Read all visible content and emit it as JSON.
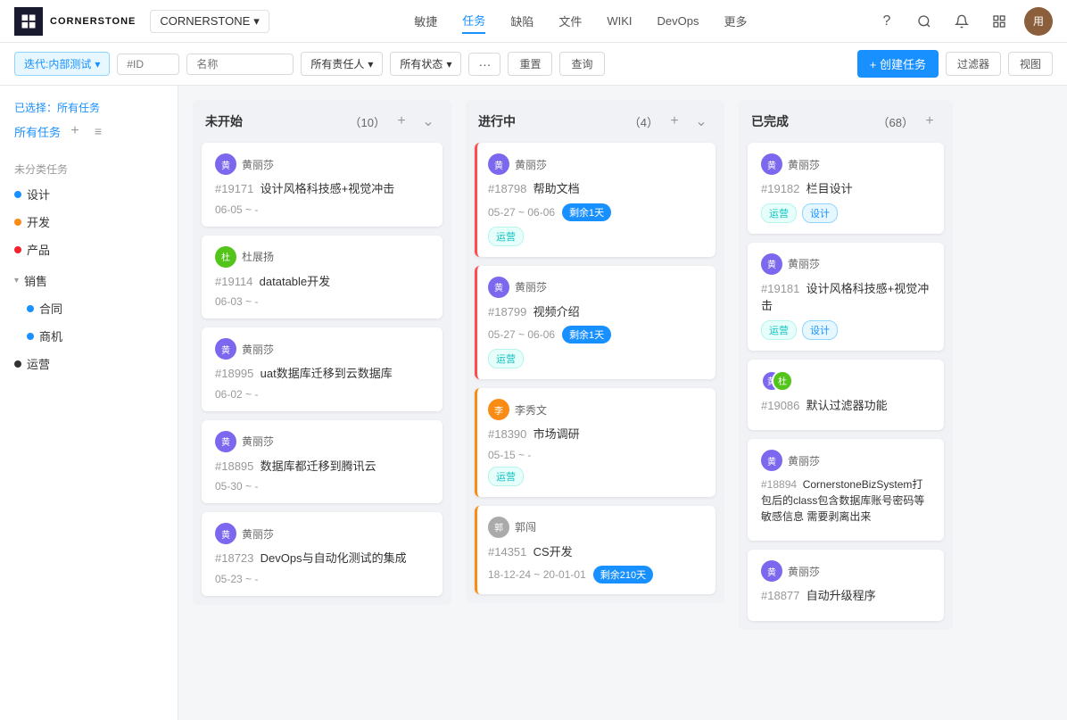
{
  "brand": {
    "logo_text": "CORNERSTONE",
    "app_name": "CORNERSTONE",
    "app_chevron": "▾"
  },
  "nav": {
    "links": [
      {
        "label": "敏捷",
        "active": false
      },
      {
        "label": "任务",
        "active": true
      },
      {
        "label": "缺陷",
        "active": false
      },
      {
        "label": "文件",
        "active": false
      },
      {
        "label": "WIKI",
        "active": false
      },
      {
        "label": "DevOps",
        "active": false
      },
      {
        "label": "更多",
        "active": false
      }
    ]
  },
  "filter_bar": {
    "iteration_label": "迭代:内部测试",
    "id_placeholder": "#ID",
    "name_placeholder": "名称",
    "owner_label": "所有责任人",
    "status_label": "所有状态",
    "dots_label": "···",
    "reset_label": "重置",
    "query_label": "查询",
    "create_label": "+ 创建任务",
    "filter_label": "过滤器",
    "view_label": "视图"
  },
  "sidebar": {
    "selected_prefix": "已选择：",
    "selected_value": "所有任务",
    "all_tasks_label": "所有任务",
    "unclassified_label": "未分类任务",
    "items": [
      {
        "label": "设计",
        "color": "#1890ff"
      },
      {
        "label": "开发",
        "color": "#fa8c16"
      },
      {
        "label": "产品",
        "color": "#f5222d"
      }
    ],
    "sales_group": {
      "label": "销售",
      "color": "#333",
      "items": [
        {
          "label": "合同",
          "color": "#1890ff"
        },
        {
          "label": "商机",
          "color": "#1890ff"
        }
      ]
    },
    "operations_label": "运营",
    "operations_color": "#333"
  },
  "board": {
    "columns": [
      {
        "title": "未开始",
        "count": 10,
        "cards": [
          {
            "user": "黄丽莎",
            "avatar_bg": "#7b68ee",
            "avatar_text": "黄",
            "id": "#19171",
            "title": "设计风格科技感+视觉冲击",
            "date": "06-05 ~ -",
            "tags": [],
            "border": ""
          },
          {
            "user": "杜展扬",
            "avatar_bg": "#52c41a",
            "avatar_text": "杜",
            "id": "#19114",
            "title": "datatable开发",
            "date": "06-03 ~ -",
            "tags": [],
            "border": ""
          },
          {
            "user": "黄丽莎",
            "avatar_bg": "#7b68ee",
            "avatar_text": "黄",
            "id": "#18995",
            "title": "uat数据库迁移到云数据库",
            "date": "06-02 ~ -",
            "tags": [],
            "border": ""
          },
          {
            "user": "黄丽莎",
            "avatar_bg": "#7b68ee",
            "avatar_text": "黄",
            "id": "#18895",
            "title": "数据库都迁移到腾讯云",
            "date": "05-30 ~ -",
            "tags": [],
            "border": ""
          },
          {
            "user": "黄丽莎",
            "avatar_bg": "#7b68ee",
            "avatar_text": "黄",
            "id": "#18723",
            "title": "DevOps与自动化测试的集成",
            "date": "05-23 ~ -",
            "tags": [],
            "border": ""
          }
        ]
      },
      {
        "title": "进行中",
        "count": 4,
        "cards": [
          {
            "user": "黄丽莎",
            "avatar_bg": "#7b68ee",
            "avatar_text": "黄",
            "id": "#18798",
            "title": "帮助文档",
            "date": "05-27 ~ 06-06",
            "badge": "剩余1天",
            "badge_color": "blue",
            "tags": [
              "运营"
            ],
            "border": "red"
          },
          {
            "user": "黄丽莎",
            "avatar_bg": "#7b68ee",
            "avatar_text": "黄",
            "id": "#18799",
            "title": "视频介绍",
            "date": "05-27 ~ 06-06",
            "badge": "剩余1天",
            "badge_color": "blue",
            "tags": [
              "运营"
            ],
            "border": "red"
          },
          {
            "user": "李秀文",
            "avatar_bg": "#fa8c16",
            "avatar_text": "李",
            "id": "#18390",
            "title": "市场调研",
            "date": "05-15 ~ -",
            "tags": [
              "运营"
            ],
            "border": "orange"
          },
          {
            "user": "郭闯",
            "avatar_bg": "#aaa",
            "avatar_text": "郭",
            "id": "#14351",
            "title": "CS开发",
            "date": "18-12-24 ~ 20-01-01",
            "badge": "剩余210天",
            "badge_color": "blue",
            "tags": [],
            "border": "orange"
          }
        ]
      },
      {
        "title": "已完成",
        "count": 68,
        "cards": [
          {
            "user": "黄丽莎",
            "avatar_bg": "#7b68ee",
            "avatar_text": "黄",
            "id": "#19182",
            "title": "栏目设计",
            "tags": [
              "运营",
              "设计"
            ],
            "border": ""
          },
          {
            "user": "黄丽莎",
            "avatar_bg": "#7b68ee",
            "avatar_text": "黄",
            "id": "#19181",
            "title": "设计风格科技感+视觉冲击",
            "tags": [
              "运营",
              "设计"
            ],
            "border": ""
          },
          {
            "user_multi": true,
            "avatar_bg1": "#7b68ee",
            "avatar_text1": "黄",
            "avatar_bg2": "#52c41a",
            "avatar_text2": "杜",
            "id": "#19086",
            "title": "默认过滤器功能",
            "tags": [],
            "border": ""
          },
          {
            "user": "黄丽莎",
            "avatar_bg": "#7b68ee",
            "avatar_text": "黄",
            "id": "#18894",
            "title": "CornerstoneBizSystem打包后的class包含数据库账号密码等敏感信息 需要剥离出来",
            "tags": [],
            "border": ""
          },
          {
            "user": "黄丽莎",
            "avatar_bg": "#7b68ee",
            "avatar_text": "黄",
            "id": "#18877",
            "title": "自动升级程序",
            "tags": [],
            "border": ""
          }
        ]
      }
    ]
  }
}
